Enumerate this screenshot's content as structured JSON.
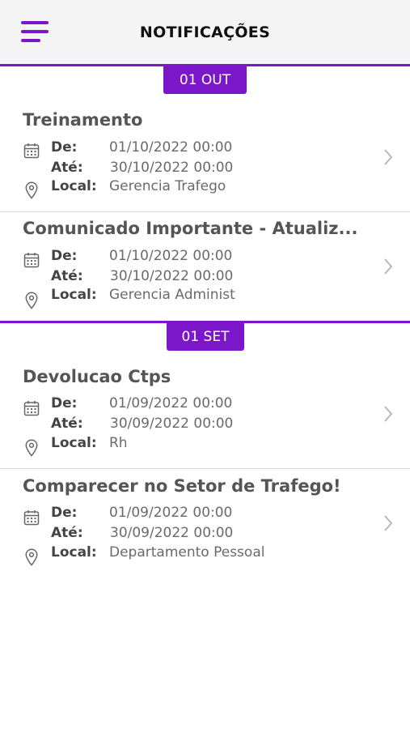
{
  "colors": {
    "accent": "#7b16c9",
    "header_bg": "#f5f5f5",
    "divider": "#dcdcdc"
  },
  "header": {
    "title": "NOTIFICAÇÕES",
    "menu_icon": "hamburger-menu-icon"
  },
  "labels": {
    "from": "De:",
    "to": "Até:",
    "location": "Local:"
  },
  "sections": [
    {
      "date_label": "01 OUT",
      "items": [
        {
          "title": "Treinamento",
          "from": "01/10/2022 00:00",
          "to": "30/10/2022 00:00",
          "location": "Gerencia Trafego"
        },
        {
          "title": "Comunicado Importante - Atualiz...",
          "from": "01/10/2022 00:00",
          "to": "30/10/2022 00:00",
          "location": "Gerencia Administ"
        }
      ]
    },
    {
      "date_label": "01 SET",
      "items": [
        {
          "title": "Devolucao Ctps",
          "from": "01/09/2022 00:00",
          "to": "30/09/2022 00:00",
          "location": "Rh"
        },
        {
          "title": "Comparecer no Setor de Trafego!",
          "from": "01/09/2022 00:00",
          "to": "30/09/2022 00:00",
          "location": "Departamento Pessoal"
        }
      ]
    }
  ]
}
